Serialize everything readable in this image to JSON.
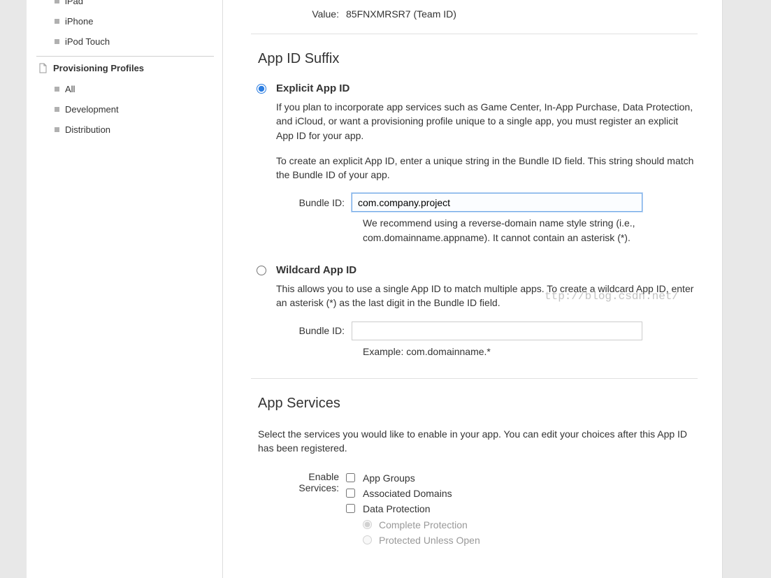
{
  "sidebar": {
    "devices_items": [
      "iPad",
      "iPhone",
      "iPod Touch"
    ],
    "profiles_header": "Provisioning Profiles",
    "profiles_items": [
      "All",
      "Development",
      "Distribution"
    ]
  },
  "prefix": {
    "value_label": "Value:",
    "value": "85FNXMRSR7 (Team ID)"
  },
  "suffix": {
    "title": "App ID Suffix",
    "explicit": {
      "label": "Explicit App ID",
      "desc1": "If you plan to incorporate app services such as Game Center, In-App Purchase, Data Protection, and iCloud, or want a provisioning profile unique to a single app, you must register an explicit App ID for your app.",
      "desc2": "To create an explicit App ID, enter a unique string in the Bundle ID field. This string should match the Bundle ID of your app.",
      "bundle_label": "Bundle ID:",
      "bundle_value": "com.company.project",
      "hint": "We recommend using a reverse-domain name style string (i.e., com.domainname.appname). It cannot contain an asterisk (*)."
    },
    "wildcard": {
      "label": "Wildcard App ID",
      "desc": "This allows you to use a single App ID to match multiple apps. To create a wildcard App ID, enter an asterisk (*) as the last digit in the Bundle ID field.",
      "bundle_label": "Bundle ID:",
      "hint": "Example: com.domainname.*"
    }
  },
  "services": {
    "title": "App Services",
    "desc": "Select the services you would like to enable in your app. You can edit your choices after this App ID has been registered.",
    "enable_label": "Enable Services:",
    "items": [
      "App Groups",
      "Associated Domains",
      "Data Protection"
    ],
    "data_protection_options": [
      "Complete Protection",
      "Protected Unless Open"
    ]
  },
  "watermark": {
    "w1": "",
    "w2": "ttp://blog.csdn.net/"
  }
}
